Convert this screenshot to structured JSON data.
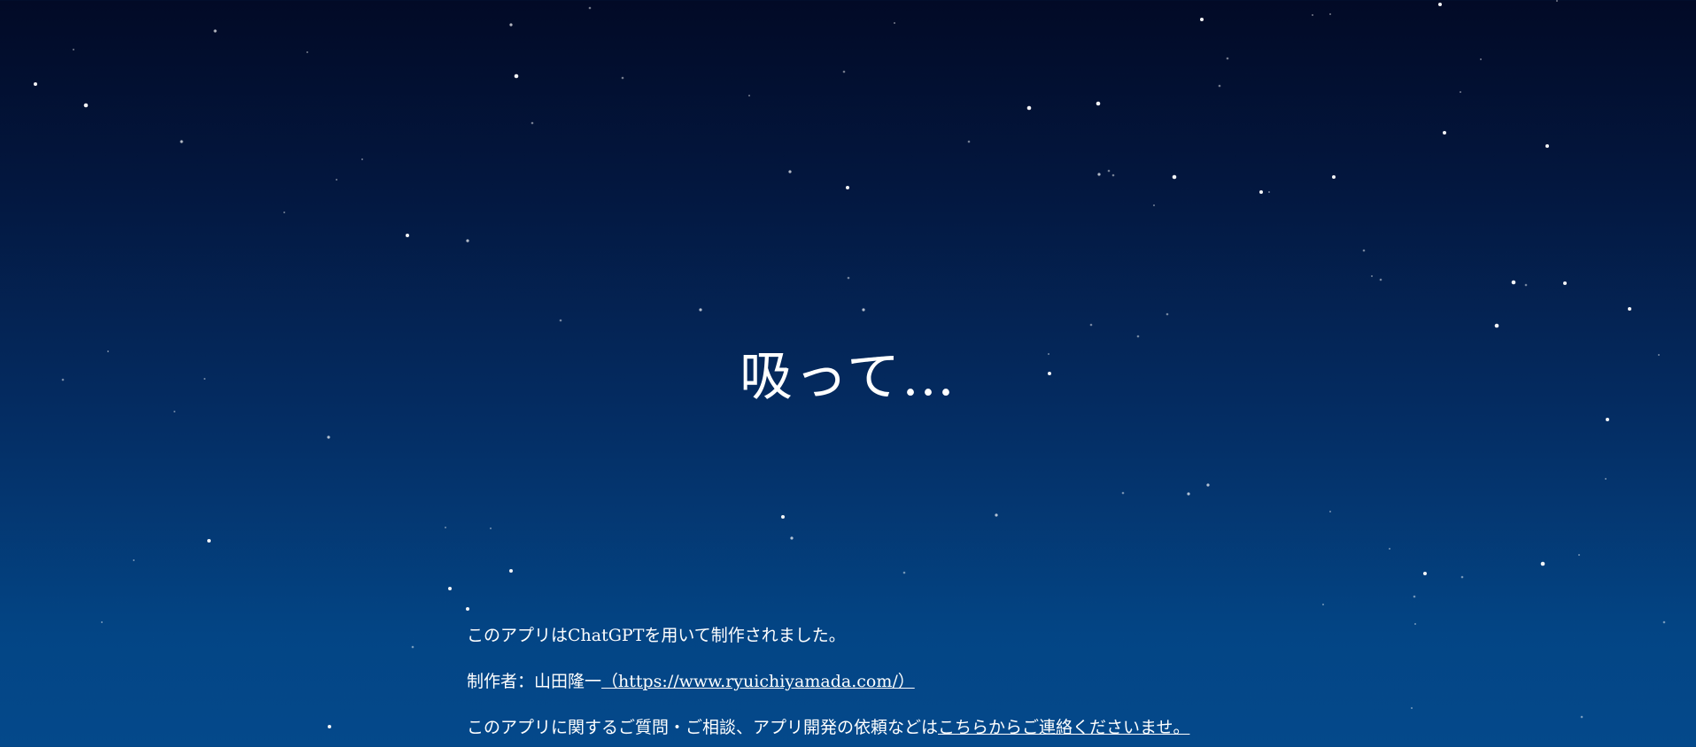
{
  "main": {
    "breath_prompt": "吸って…"
  },
  "footer": {
    "made_with_text": "このアプリはChatGPTを用いて制作されました。",
    "author_label": "制作者：山田隆一",
    "author_link_text": "（https://www.ryuichiyamada.com/）",
    "contact_prefix": "このアプリに関するご質問・ご相談、アプリ開発の依頼などは",
    "contact_link_text": "こちらからご連絡くださいませ。"
  },
  "theme": {
    "text_color": "#ffffff",
    "sky_top": "#020a26",
    "sky_bottom": "#04498b"
  }
}
